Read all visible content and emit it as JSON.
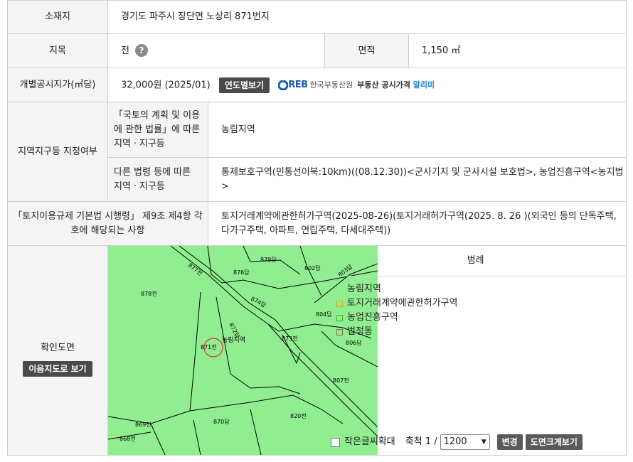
{
  "rows": {
    "location": {
      "label": "소재지",
      "value": "경기도 파주시 장단면 노상리 871번지"
    },
    "land_category": {
      "label": "지목",
      "value": "전",
      "help": "?"
    },
    "area": {
      "label": "면적",
      "value": "1,150 ㎡"
    },
    "price": {
      "label": "개별공시지가(㎡당)",
      "value": "32,000원 (2025/01)",
      "button": "연도별보기"
    },
    "reb": {
      "logo": "REB",
      "agency": "한국부동산원",
      "alert_prefix": "부동산 공시가격",
      "alert_highlight": "알리미"
    },
    "zone": {
      "label": "지역지구등 지정여부",
      "law1_label": "「국토의 계획 및 이용에 관한 법률」에 따른 지역ㆍ지구등",
      "law1_value": "농림지역",
      "law2_label": "다른 법령 등에 따른 지역ㆍ지구등",
      "law2_value": "통제보호구역(민통선이북:10km)((08.12.30))<군사기지 및 군사시설 보호법>, 농업진흥구역<농지법>"
    },
    "regulation": {
      "label": "「토지이용규제 기본법 시행령」 제9조 제4항 각 호에 해당되는 사항",
      "value": "토지거래계약에관한허가구역(2025-08-26)(토지거래허가구역(2025. 8. 26 )(외국인 등의 단독주택, 다가구주택, 아파트, 연립주택, 다세대주택))"
    },
    "map": {
      "label": "확인도면",
      "button": "이음지도로 보기"
    }
  },
  "legend": {
    "title": "범례",
    "items": [
      {
        "label": "농림지역",
        "color": "#90ee90",
        "style": "fill"
      },
      {
        "label": "토지거래계약에관한허가구역",
        "color": "#e6a817",
        "style": "outline"
      },
      {
        "label": "농업진흥구역",
        "color": "#3cb043",
        "style": "outline"
      },
      {
        "label": "법정동",
        "color": "#8a6d4a",
        "style": "outline"
      }
    ]
  },
  "controls": {
    "small_text_label": "작은글씨확대",
    "scale_label": "축척 1 /",
    "scale_value": "1200",
    "change_button": "변경",
    "enlarge_button": "도면크게보기"
  },
  "map_labels": {
    "p877": "877전",
    "p876": "876답",
    "p878": "878전",
    "p879": "879답",
    "p802": "802답",
    "p803": "803답",
    "p874": "874답",
    "p872": "872답",
    "p804": "804답",
    "p871": "871전",
    "zone": "농림지역",
    "p873": "873전",
    "p806": "806답",
    "p807": "807전",
    "p870": "870답",
    "p820": "820전",
    "p869": "869전",
    "p868": "868전"
  }
}
